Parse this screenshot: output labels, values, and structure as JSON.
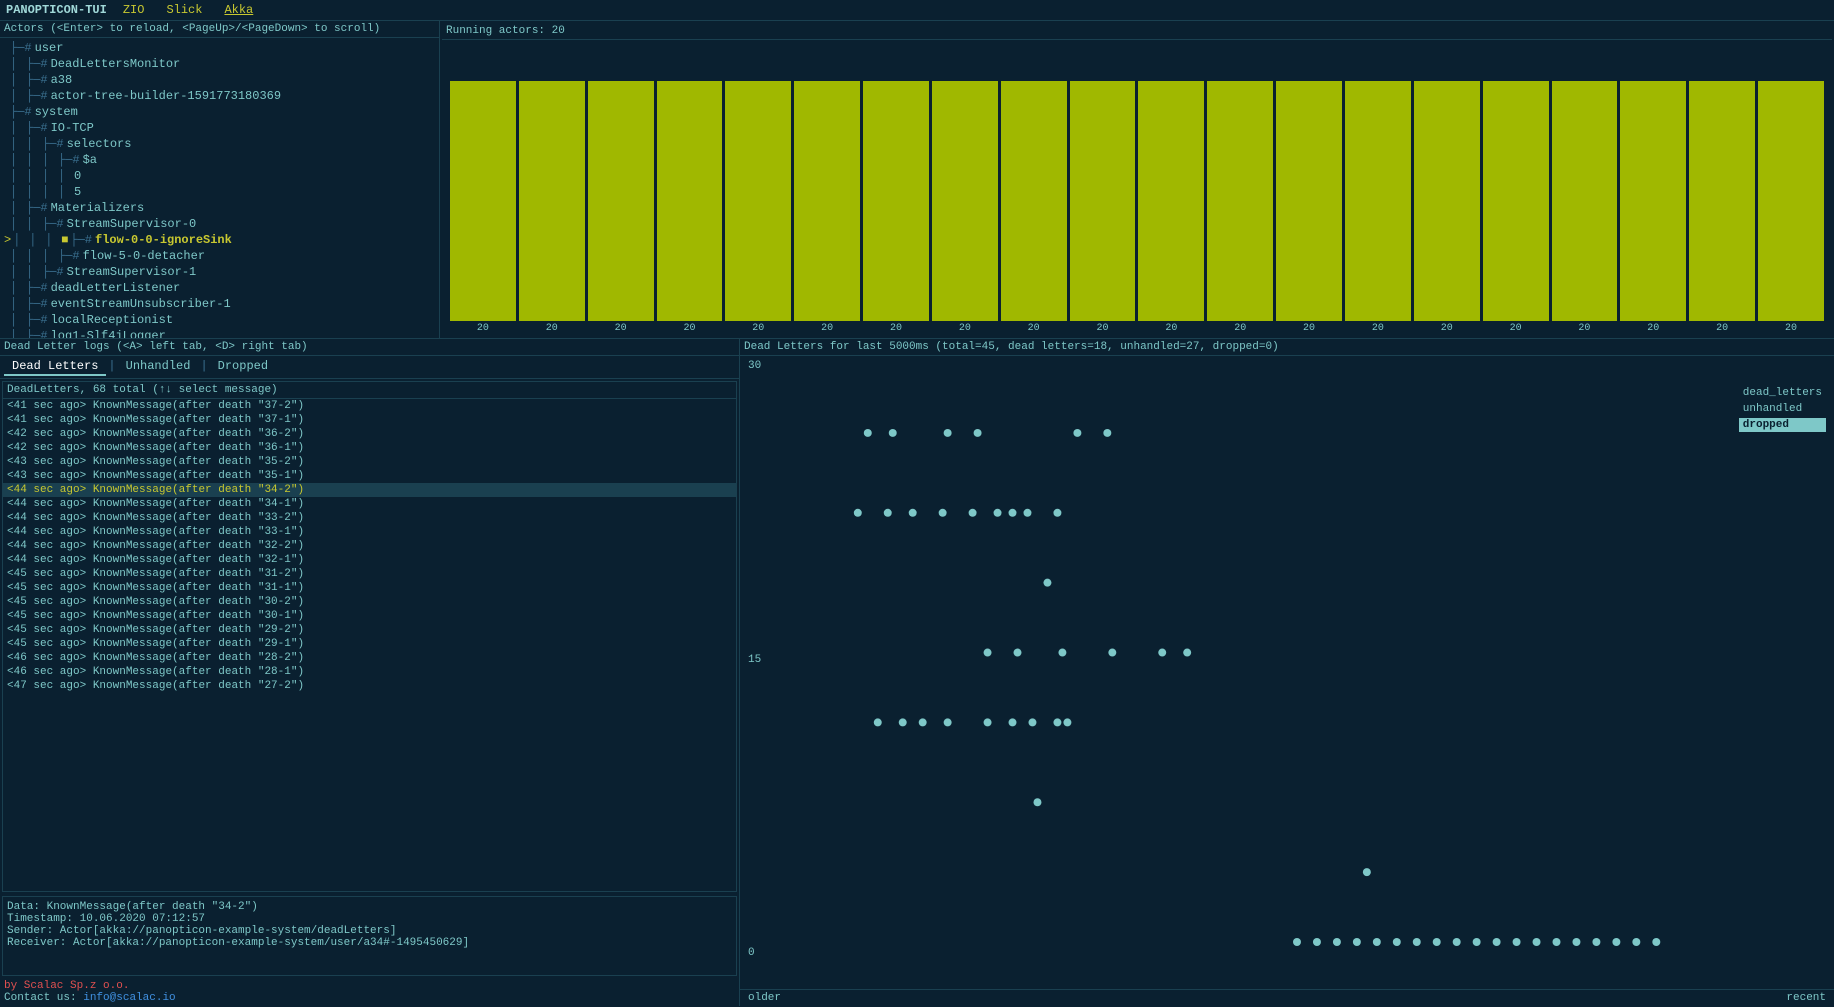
{
  "titleBar": {
    "appName": "PANOPTICON-TUI",
    "tabs": [
      {
        "label": "ZIO",
        "active": false
      },
      {
        "label": "Slick",
        "active": false
      },
      {
        "label": "Akka",
        "active": true
      }
    ]
  },
  "actorsPanel": {
    "header": "Actors (<Enter> to reload, <PageUp>/<PageDown> to scroll)",
    "tree": [
      {
        "indent": 1,
        "connector": "#",
        "label": "user",
        "selected": false
      },
      {
        "indent": 2,
        "connector": "#",
        "label": "DeadLettersMonitor",
        "selected": false
      },
      {
        "indent": 2,
        "connector": "#",
        "label": "a38",
        "selected": false
      },
      {
        "indent": 2,
        "connector": "#",
        "label": "actor-tree-builder-1591773180369",
        "selected": false
      },
      {
        "indent": 1,
        "connector": "#",
        "label": "system",
        "selected": false
      },
      {
        "indent": 2,
        "connector": "#",
        "label": "IO-TCP",
        "selected": false
      },
      {
        "indent": 3,
        "connector": "#",
        "label": "selectors",
        "selected": false
      },
      {
        "indent": 4,
        "connector": "#",
        "label": "$a",
        "selected": false
      },
      {
        "indent": 5,
        "connector": "",
        "label": "0",
        "selected": false
      },
      {
        "indent": 5,
        "connector": "",
        "label": "5",
        "selected": false
      },
      {
        "indent": 2,
        "connector": "#",
        "label": "Materializers",
        "selected": false
      },
      {
        "indent": 3,
        "connector": "#",
        "label": "StreamSupervisor-0",
        "selected": false
      },
      {
        "indent": 4,
        "connector": "#",
        "label": "flow-0-0-ignoreSink",
        "selected": true
      },
      {
        "indent": 4,
        "connector": "#",
        "label": "flow-5-0-detacher",
        "selected": false
      },
      {
        "indent": 3,
        "connector": "#",
        "label": "StreamSupervisor-1",
        "selected": false
      },
      {
        "indent": 2,
        "connector": "#",
        "label": "deadLetterListener",
        "selected": false
      },
      {
        "indent": 2,
        "connector": "#",
        "label": "eventStreamUnsubscriber-1",
        "selected": false
      },
      {
        "indent": 2,
        "connector": "#",
        "label": "localReceptionist",
        "selected": false
      },
      {
        "indent": 2,
        "connector": "#",
        "label": "log1-Slf4jLogger",
        "selected": false
      }
    ]
  },
  "chart": {
    "header": "Running actors: 20",
    "barCount": 20,
    "barValue": 20,
    "barHeight": 240,
    "barLabel": "20"
  },
  "logTabs": {
    "header": "Dead Letter logs (<A> left tab, <D> right tab)",
    "tabs": [
      {
        "label": "Dead Letters",
        "active": true
      },
      {
        "label": "Unhandled",
        "active": false
      },
      {
        "label": "Dropped",
        "active": false
      }
    ]
  },
  "deadLetters": {
    "header": "DeadLetters, 68 total (↑↓ select message)",
    "entries": [
      {
        "time": "<41 sec ago>",
        "msg": "KnownMessage(after death \"37-2\")",
        "selected": false
      },
      {
        "time": "<41 sec ago>",
        "msg": "KnownMessage(after death \"37-1\")",
        "selected": false
      },
      {
        "time": "<42 sec ago>",
        "msg": "KnownMessage(after death \"36-2\")",
        "selected": false
      },
      {
        "time": "<42 sec ago>",
        "msg": "KnownMessage(after death \"36-1\")",
        "selected": false
      },
      {
        "time": "<43 sec ago>",
        "msg": "KnownMessage(after death \"35-2\")",
        "selected": false
      },
      {
        "time": "<43 sec ago>",
        "msg": "KnownMessage(after death \"35-1\")",
        "selected": false
      },
      {
        "time": "<44 sec ago>",
        "msg": "KnownMessage(after death \"34-2\")",
        "selected": true
      },
      {
        "time": "<44 sec ago>",
        "msg": "KnownMessage(after death \"34-1\")",
        "selected": false
      },
      {
        "time": "<44 sec ago>",
        "msg": "KnownMessage(after death \"33-2\")",
        "selected": false
      },
      {
        "time": "<44 sec ago>",
        "msg": "KnownMessage(after death \"33-1\")",
        "selected": false
      },
      {
        "time": "<44 sec ago>",
        "msg": "KnownMessage(after death \"32-2\")",
        "selected": false
      },
      {
        "time": "<44 sec ago>",
        "msg": "KnownMessage(after death \"32-1\")",
        "selected": false
      },
      {
        "time": "<45 sec ago>",
        "msg": "KnownMessage(after death \"31-2\")",
        "selected": false
      },
      {
        "time": "<45 sec ago>",
        "msg": "KnownMessage(after death \"31-1\")",
        "selected": false
      },
      {
        "time": "<45 sec ago>",
        "msg": "KnownMessage(after death \"30-2\")",
        "selected": false
      },
      {
        "time": "<45 sec ago>",
        "msg": "KnownMessage(after death \"30-1\")",
        "selected": false
      },
      {
        "time": "<45 sec ago>",
        "msg": "KnownMessage(after death \"29-2\")",
        "selected": false
      },
      {
        "time": "<45 sec ago>",
        "msg": "KnownMessage(after death \"29-1\")",
        "selected": false
      },
      {
        "time": "<46 sec ago>",
        "msg": "KnownMessage(after death \"28-2\")",
        "selected": false
      },
      {
        "time": "<46 sec ago>",
        "msg": "KnownMessage(after death \"28-1\")",
        "selected": false
      },
      {
        "time": "<47 sec ago>",
        "msg": "KnownMessage(after death \"27-2\")",
        "selected": false
      }
    ],
    "detail": {
      "data": "Data: KnownMessage(after death \"34-2\")",
      "timestamp": "Timestamp: 10.06.2020 07:12:57",
      "sender": "Sender: Actor[akka://panopticon-example-system/deadLetters]",
      "receiver": "Receiver: Actor[akka://panopticon-example-system/user/a34#-1495450629]"
    }
  },
  "dlChart": {
    "header": "Dead Letters for last 5000ms (total=45, dead letters=18, unhandled=27, dropped=0)",
    "yAxisLabels": [
      "30",
      "15",
      "0"
    ],
    "xAxisLabels": [
      "older",
      "recent"
    ],
    "legend": [
      {
        "label": "dead_letters",
        "style": "dead-letters"
      },
      {
        "label": "unhandled",
        "style": "unhandled"
      },
      {
        "label": "dropped",
        "style": "dropped"
      }
    ]
  },
  "footer": {
    "byLine": "by Scalac Sp.z o.o.",
    "contactLabel": "Contact us:",
    "email": "info@scalac.io"
  }
}
